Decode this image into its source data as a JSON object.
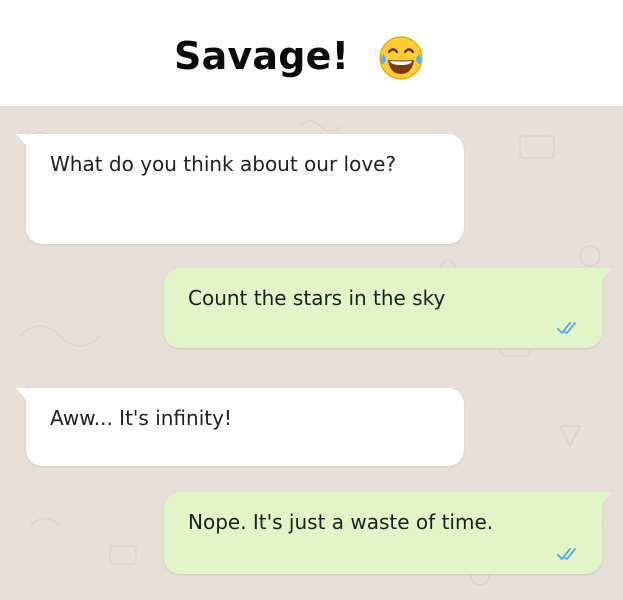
{
  "header": {
    "title": "Savage!",
    "emoji": "face-with-tears-of-joy"
  },
  "chat": {
    "background_color": "#e7dfd7",
    "messages": [
      {
        "direction": "incoming",
        "text": "What do you think about our love?"
      },
      {
        "direction": "outgoing",
        "text": "Count the stars in the sky",
        "status": "read",
        "status_icon": "double-check-icon"
      },
      {
        "direction": "incoming",
        "text": "Aww... It's infinity!"
      },
      {
        "direction": "outgoing",
        "text": "Nope. It's just a waste of time.",
        "status": "read",
        "status_icon": "double-check-icon"
      }
    ]
  },
  "colors": {
    "incoming_bubble": "#ffffff",
    "outgoing_bubble": "#e1f5c7",
    "read_ticks": "#4fa3e0",
    "text": "#1f1f1f"
  }
}
